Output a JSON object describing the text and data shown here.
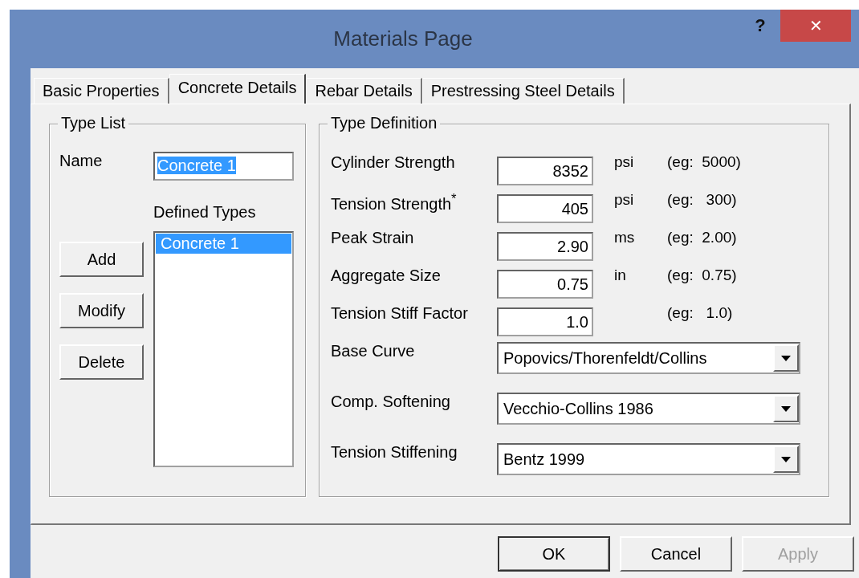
{
  "window": {
    "title": "Materials Page",
    "help_label": "?",
    "close_label": "✕"
  },
  "tabs": [
    {
      "label": "Basic Properties",
      "selected": false
    },
    {
      "label": "Concrete Details",
      "selected": true
    },
    {
      "label": "Rebar Details",
      "selected": false
    },
    {
      "label": "Prestressing Steel Details",
      "selected": false
    }
  ],
  "type_list": {
    "title": "Type List",
    "name_label": "Name",
    "name_field": {
      "value": "Concrete 1",
      "selected": true
    },
    "defined_types_label": "Defined Types",
    "buttons": [
      {
        "label": "Add"
      },
      {
        "label": "Modify"
      },
      {
        "label": "Delete"
      }
    ],
    "defined_types": [
      {
        "label": "Concrete 1",
        "selected": true
      }
    ]
  },
  "type_definition": {
    "title": "Type Definition",
    "rows": [
      {
        "kind": "number",
        "label": "Cylinder Strength",
        "value": "8352",
        "unit": "psi",
        "example": "(eg:  5000)"
      },
      {
        "kind": "number",
        "label": "Tension Strength$^{*}$",
        "value": "405",
        "unit": "psi",
        "example": "(eg:   300)"
      },
      {
        "kind": "number",
        "label": "Peak Strain",
        "value": "2.90",
        "unit": "ms",
        "example": "(eg:  2.00)"
      },
      {
        "kind": "number",
        "label": "Aggregate Size",
        "value": "0.75",
        "unit": "in",
        "example": "(eg:  0.75)"
      },
      {
        "kind": "number",
        "label": "Tension Stiff Factor",
        "value": "1.0",
        "example": "(eg:   1.0)"
      },
      {
        "kind": "dropdown",
        "label": "Base Curve",
        "value": "Popovics/Thorenfeldt/Collins"
      },
      {
        "kind": "dropdown",
        "label": "Comp. Softening",
        "value": "Vecchio-Collins 1986"
      },
      {
        "kind": "dropdown",
        "label": "Tension Stiffening",
        "value": "Bentz 1999"
      }
    ]
  },
  "buttons": [
    {
      "label": "OK",
      "disabled": false,
      "default": true
    },
    {
      "label": "Cancel",
      "disabled": false,
      "default": false
    },
    {
      "label": "Apply",
      "disabled": true,
      "default": false
    }
  ]
}
